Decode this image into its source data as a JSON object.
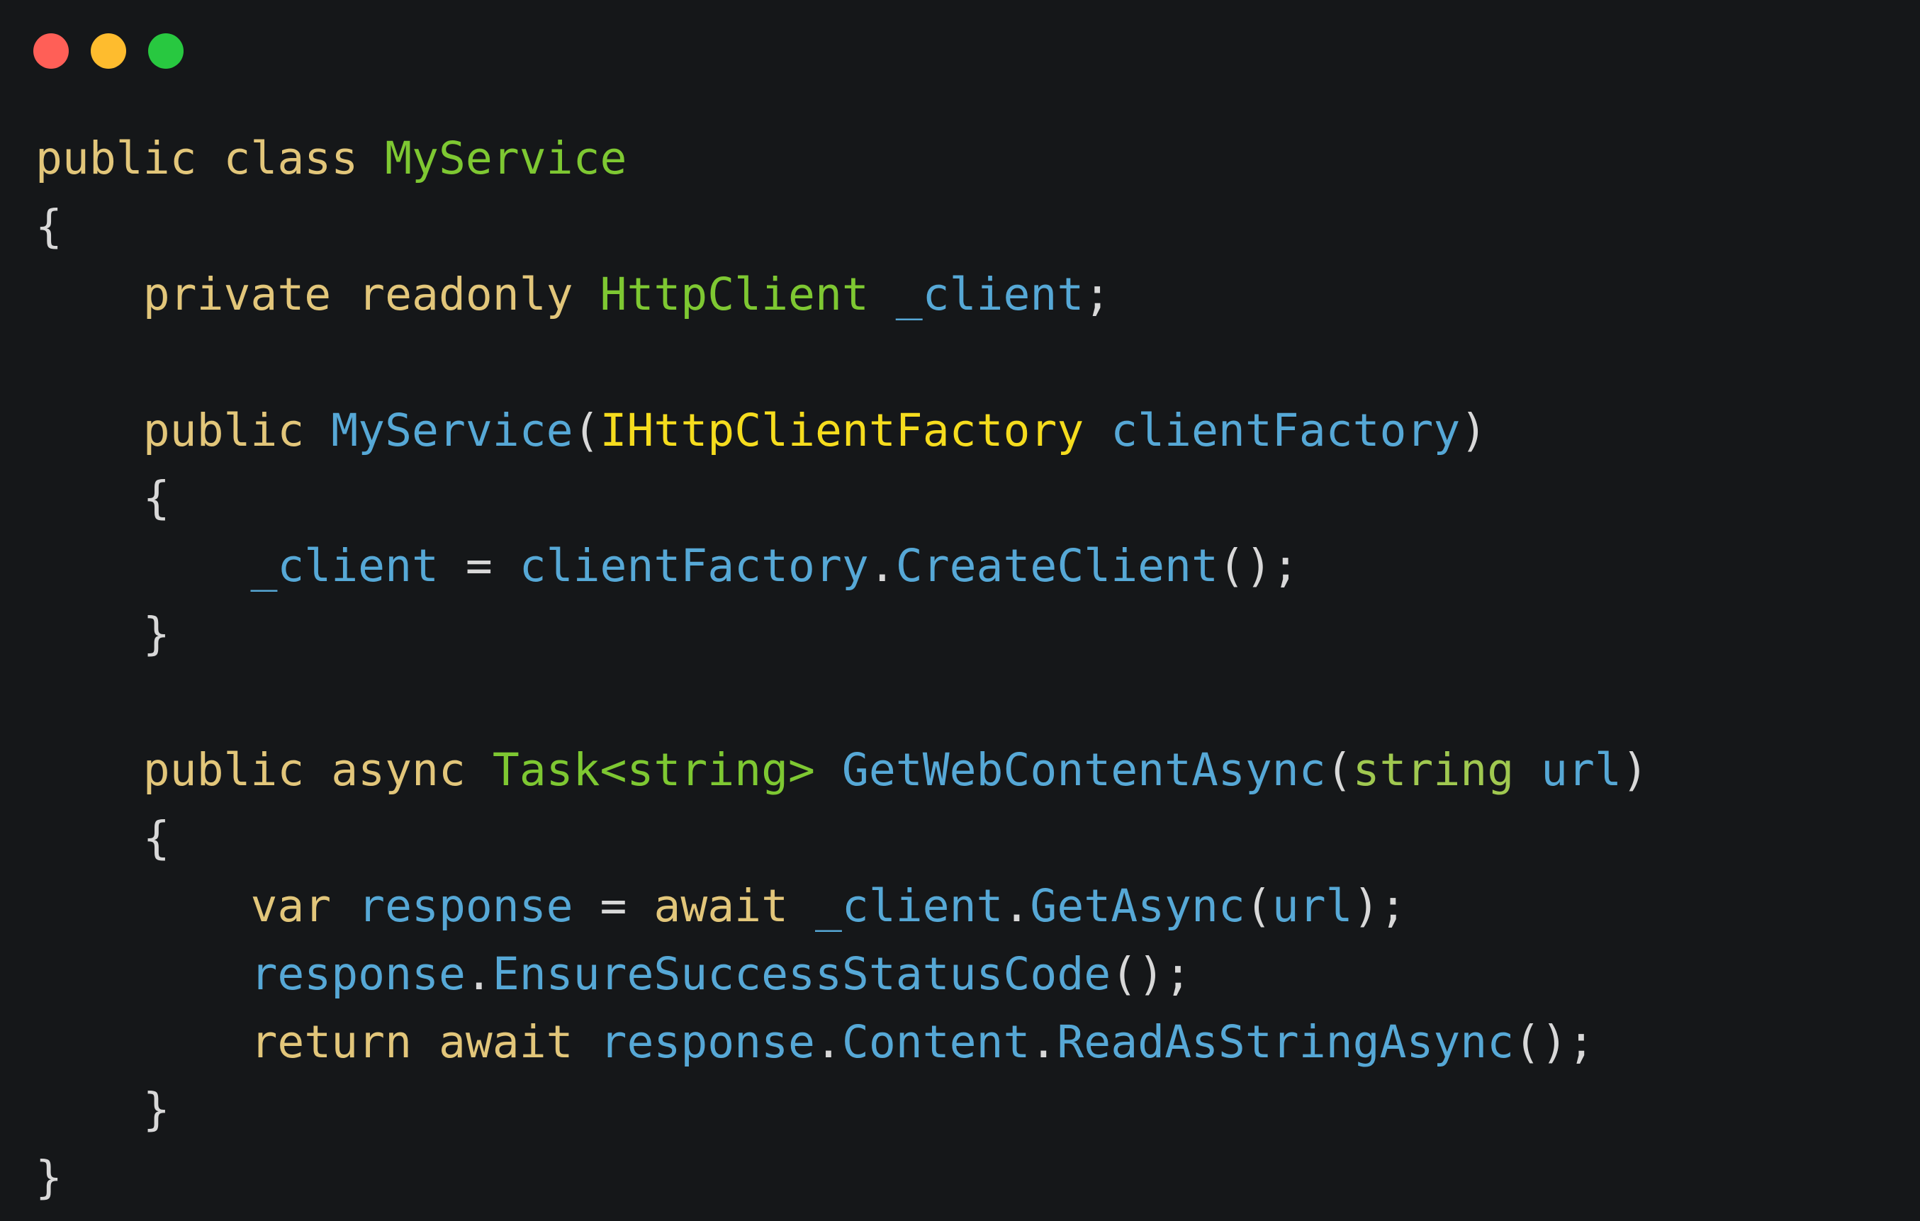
{
  "colors": {
    "background": "#151719",
    "traffic_close": "#ff5f57",
    "traffic_minimize": "#febc2e",
    "traffic_zoom": "#28c840",
    "keyword": "#e2c67a",
    "type": "#7ec832",
    "type_param": "#f5dc1e",
    "identifier": "#56a8d6",
    "punctuation": "#d8d8d8",
    "string_type": "#a0c850"
  },
  "window_controls": [
    {
      "name": "close",
      "color": "#ff5f57"
    },
    {
      "name": "minimize",
      "color": "#febc2e"
    },
    {
      "name": "zoom",
      "color": "#28c840"
    }
  ],
  "code_lines": [
    [
      {
        "t": "public class ",
        "c": "keyword"
      },
      {
        "t": "MyService",
        "c": "type"
      }
    ],
    [
      {
        "t": "{",
        "c": "punctuation"
      }
    ],
    [
      {
        "t": "    ",
        "c": "punctuation"
      },
      {
        "t": "private readonly ",
        "c": "keyword"
      },
      {
        "t": "HttpClient ",
        "c": "type"
      },
      {
        "t": "_client",
        "c": "identifier"
      },
      {
        "t": ";",
        "c": "punctuation"
      }
    ],
    [],
    [
      {
        "t": "    ",
        "c": "punctuation"
      },
      {
        "t": "public ",
        "c": "keyword"
      },
      {
        "t": "MyService",
        "c": "identifier"
      },
      {
        "t": "(",
        "c": "punctuation"
      },
      {
        "t": "IHttpClientFactory ",
        "c": "type_param"
      },
      {
        "t": "clientFactory",
        "c": "identifier"
      },
      {
        "t": ")",
        "c": "punctuation"
      }
    ],
    [
      {
        "t": "    {",
        "c": "punctuation"
      }
    ],
    [
      {
        "t": "        ",
        "c": "punctuation"
      },
      {
        "t": "_client ",
        "c": "identifier"
      },
      {
        "t": "= ",
        "c": "punctuation"
      },
      {
        "t": "clientFactory",
        "c": "identifier"
      },
      {
        "t": ".",
        "c": "punctuation"
      },
      {
        "t": "CreateClient",
        "c": "identifier"
      },
      {
        "t": "();",
        "c": "punctuation"
      }
    ],
    [
      {
        "t": "    }",
        "c": "punctuation"
      }
    ],
    [],
    [
      {
        "t": "    ",
        "c": "punctuation"
      },
      {
        "t": "public async ",
        "c": "keyword"
      },
      {
        "t": "Task<string> ",
        "c": "type"
      },
      {
        "t": "GetWebContentAsync",
        "c": "identifier"
      },
      {
        "t": "(",
        "c": "punctuation"
      },
      {
        "t": "string ",
        "c": "string_type"
      },
      {
        "t": "url",
        "c": "identifier"
      },
      {
        "t": ")",
        "c": "punctuation"
      }
    ],
    [
      {
        "t": "    {",
        "c": "punctuation"
      }
    ],
    [
      {
        "t": "        ",
        "c": "punctuation"
      },
      {
        "t": "var ",
        "c": "keyword"
      },
      {
        "t": "response ",
        "c": "identifier"
      },
      {
        "t": "= ",
        "c": "punctuation"
      },
      {
        "t": "await ",
        "c": "keyword"
      },
      {
        "t": "_client",
        "c": "identifier"
      },
      {
        "t": ".",
        "c": "punctuation"
      },
      {
        "t": "GetAsync",
        "c": "identifier"
      },
      {
        "t": "(",
        "c": "punctuation"
      },
      {
        "t": "url",
        "c": "identifier"
      },
      {
        "t": ");",
        "c": "punctuation"
      }
    ],
    [
      {
        "t": "        ",
        "c": "punctuation"
      },
      {
        "t": "response",
        "c": "identifier"
      },
      {
        "t": ".",
        "c": "punctuation"
      },
      {
        "t": "EnsureSuccessStatusCode",
        "c": "identifier"
      },
      {
        "t": "();",
        "c": "punctuation"
      }
    ],
    [
      {
        "t": "        ",
        "c": "punctuation"
      },
      {
        "t": "return await ",
        "c": "keyword"
      },
      {
        "t": "response",
        "c": "identifier"
      },
      {
        "t": ".",
        "c": "punctuation"
      },
      {
        "t": "Content",
        "c": "identifier"
      },
      {
        "t": ".",
        "c": "punctuation"
      },
      {
        "t": "ReadAsStringAsync",
        "c": "identifier"
      },
      {
        "t": "();",
        "c": "punctuation"
      }
    ],
    [
      {
        "t": "    }",
        "c": "punctuation"
      }
    ],
    [
      {
        "t": "}",
        "c": "punctuation"
      }
    ]
  ]
}
